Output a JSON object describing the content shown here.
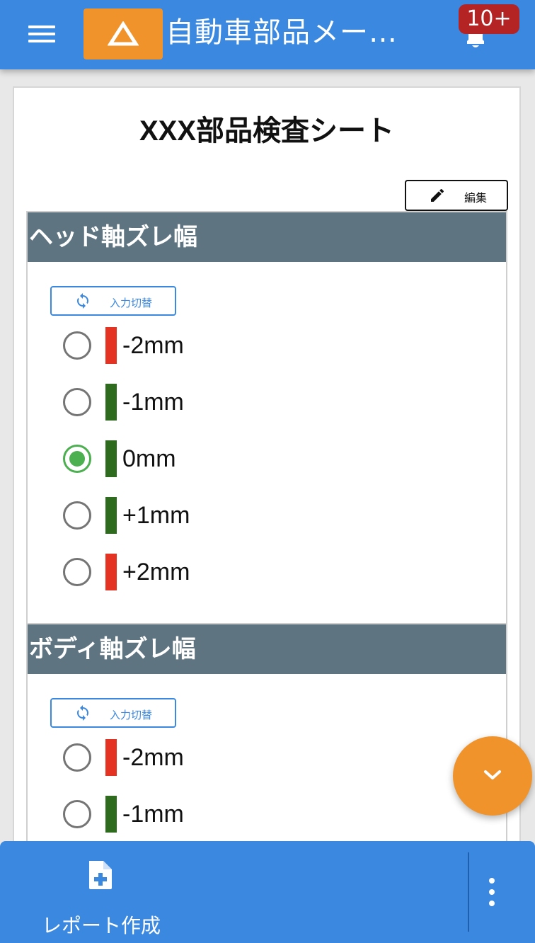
{
  "app": {
    "title": "自動車部品メー…",
    "notification_count": "10+"
  },
  "sheet": {
    "title": "XXX部品検査シート",
    "edit_label": "編集"
  },
  "sections": [
    {
      "header": "ヘッド軸ズレ幅",
      "switch_label": "入力切替",
      "options": [
        {
          "label": "-2mm",
          "status": "ng",
          "color": "#e53323",
          "checked": false
        },
        {
          "label": "-1mm",
          "status": "ok",
          "color": "#2e6b1e",
          "checked": false
        },
        {
          "label": "0mm",
          "status": "ok",
          "color": "#2e6b1e",
          "checked": true
        },
        {
          "label": "+1mm",
          "status": "ok",
          "color": "#2e6b1e",
          "checked": false
        },
        {
          "label": "+2mm",
          "status": "ng",
          "color": "#e53323",
          "checked": false
        }
      ]
    },
    {
      "header": "ボディ軸ズレ幅",
      "switch_label": "入力切替",
      "options": [
        {
          "label": "-2mm",
          "status": "ng",
          "color": "#e53323",
          "checked": false
        },
        {
          "label": "-1mm",
          "status": "ok",
          "color": "#2e6b1e",
          "checked": false
        }
      ]
    }
  ],
  "bottom": {
    "report_label": "レポート作成"
  },
  "colors": {
    "primary": "#3b88e0",
    "accent": "#f0932b",
    "badge": "#b52424",
    "section_header": "#5f7481",
    "ok": "#2e6b1e",
    "ng": "#e53323",
    "checked": "#4caf50"
  },
  "icons": {
    "menu": "menu-icon",
    "logo": "warning-triangle-icon",
    "notifications": "bell-icon",
    "edit": "pencil-icon",
    "switch": "sync-icon",
    "fab": "chevron-down-icon",
    "report": "file-plus-icon",
    "more": "more-vertical-icon"
  }
}
